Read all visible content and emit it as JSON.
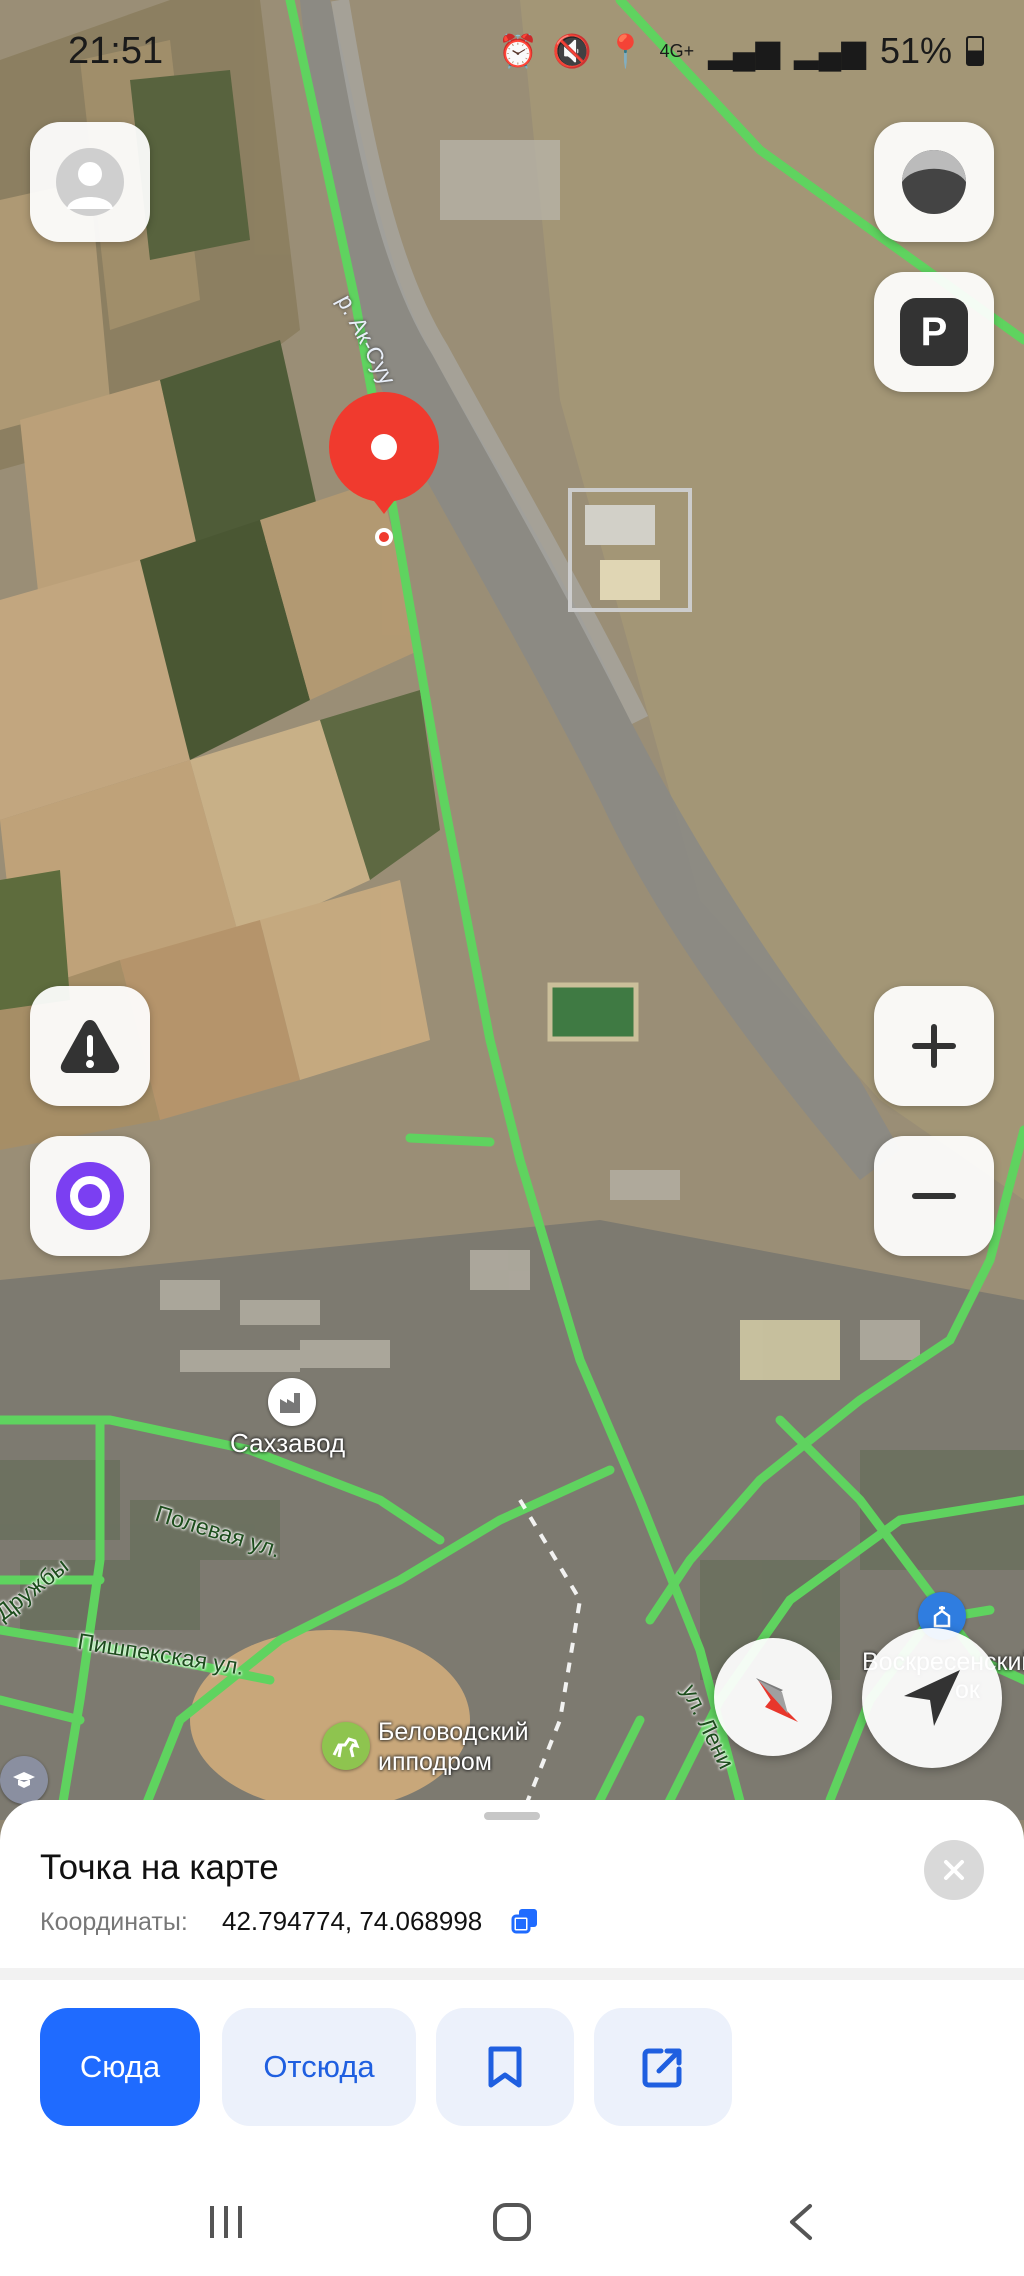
{
  "status_bar": {
    "time": "21:51",
    "battery": "51%",
    "network": "4G+",
    "icons": [
      "alarm-icon",
      "mute-icon",
      "location-icon",
      "signal-icon",
      "signal-icon",
      "battery-icon"
    ]
  },
  "map": {
    "labels": {
      "river": "р. Ак-Суу",
      "sugar_factory": "Сахзавод",
      "polevaya": "Полевая ул.",
      "pishpekskaya": "Пишпекская ул.",
      "druzhby": "Дружбы",
      "lenina": "ул. Лени",
      "hippodrome_1": "Беловодский",
      "hippodrome_2": "ипподром",
      "church_1": "Воскресенский",
      "church_2": "ок"
    },
    "road_color": "#5fd35f",
    "pin_color": "#f03a2e",
    "controls": [
      "profile-button",
      "layers-button",
      "parking-button",
      "alert-button",
      "alice-button",
      "zoom-in-button",
      "zoom-out-button",
      "compass-button",
      "my-location-button"
    ],
    "parking_label": "P"
  },
  "sheet": {
    "title": "Точка на карте",
    "coords_label": "Координаты:",
    "coords_value": "42.794774, 74.068998",
    "buttons": {
      "to_here": "Сюда",
      "from_here": "Отсюда"
    },
    "accent": "#1f6bff"
  }
}
